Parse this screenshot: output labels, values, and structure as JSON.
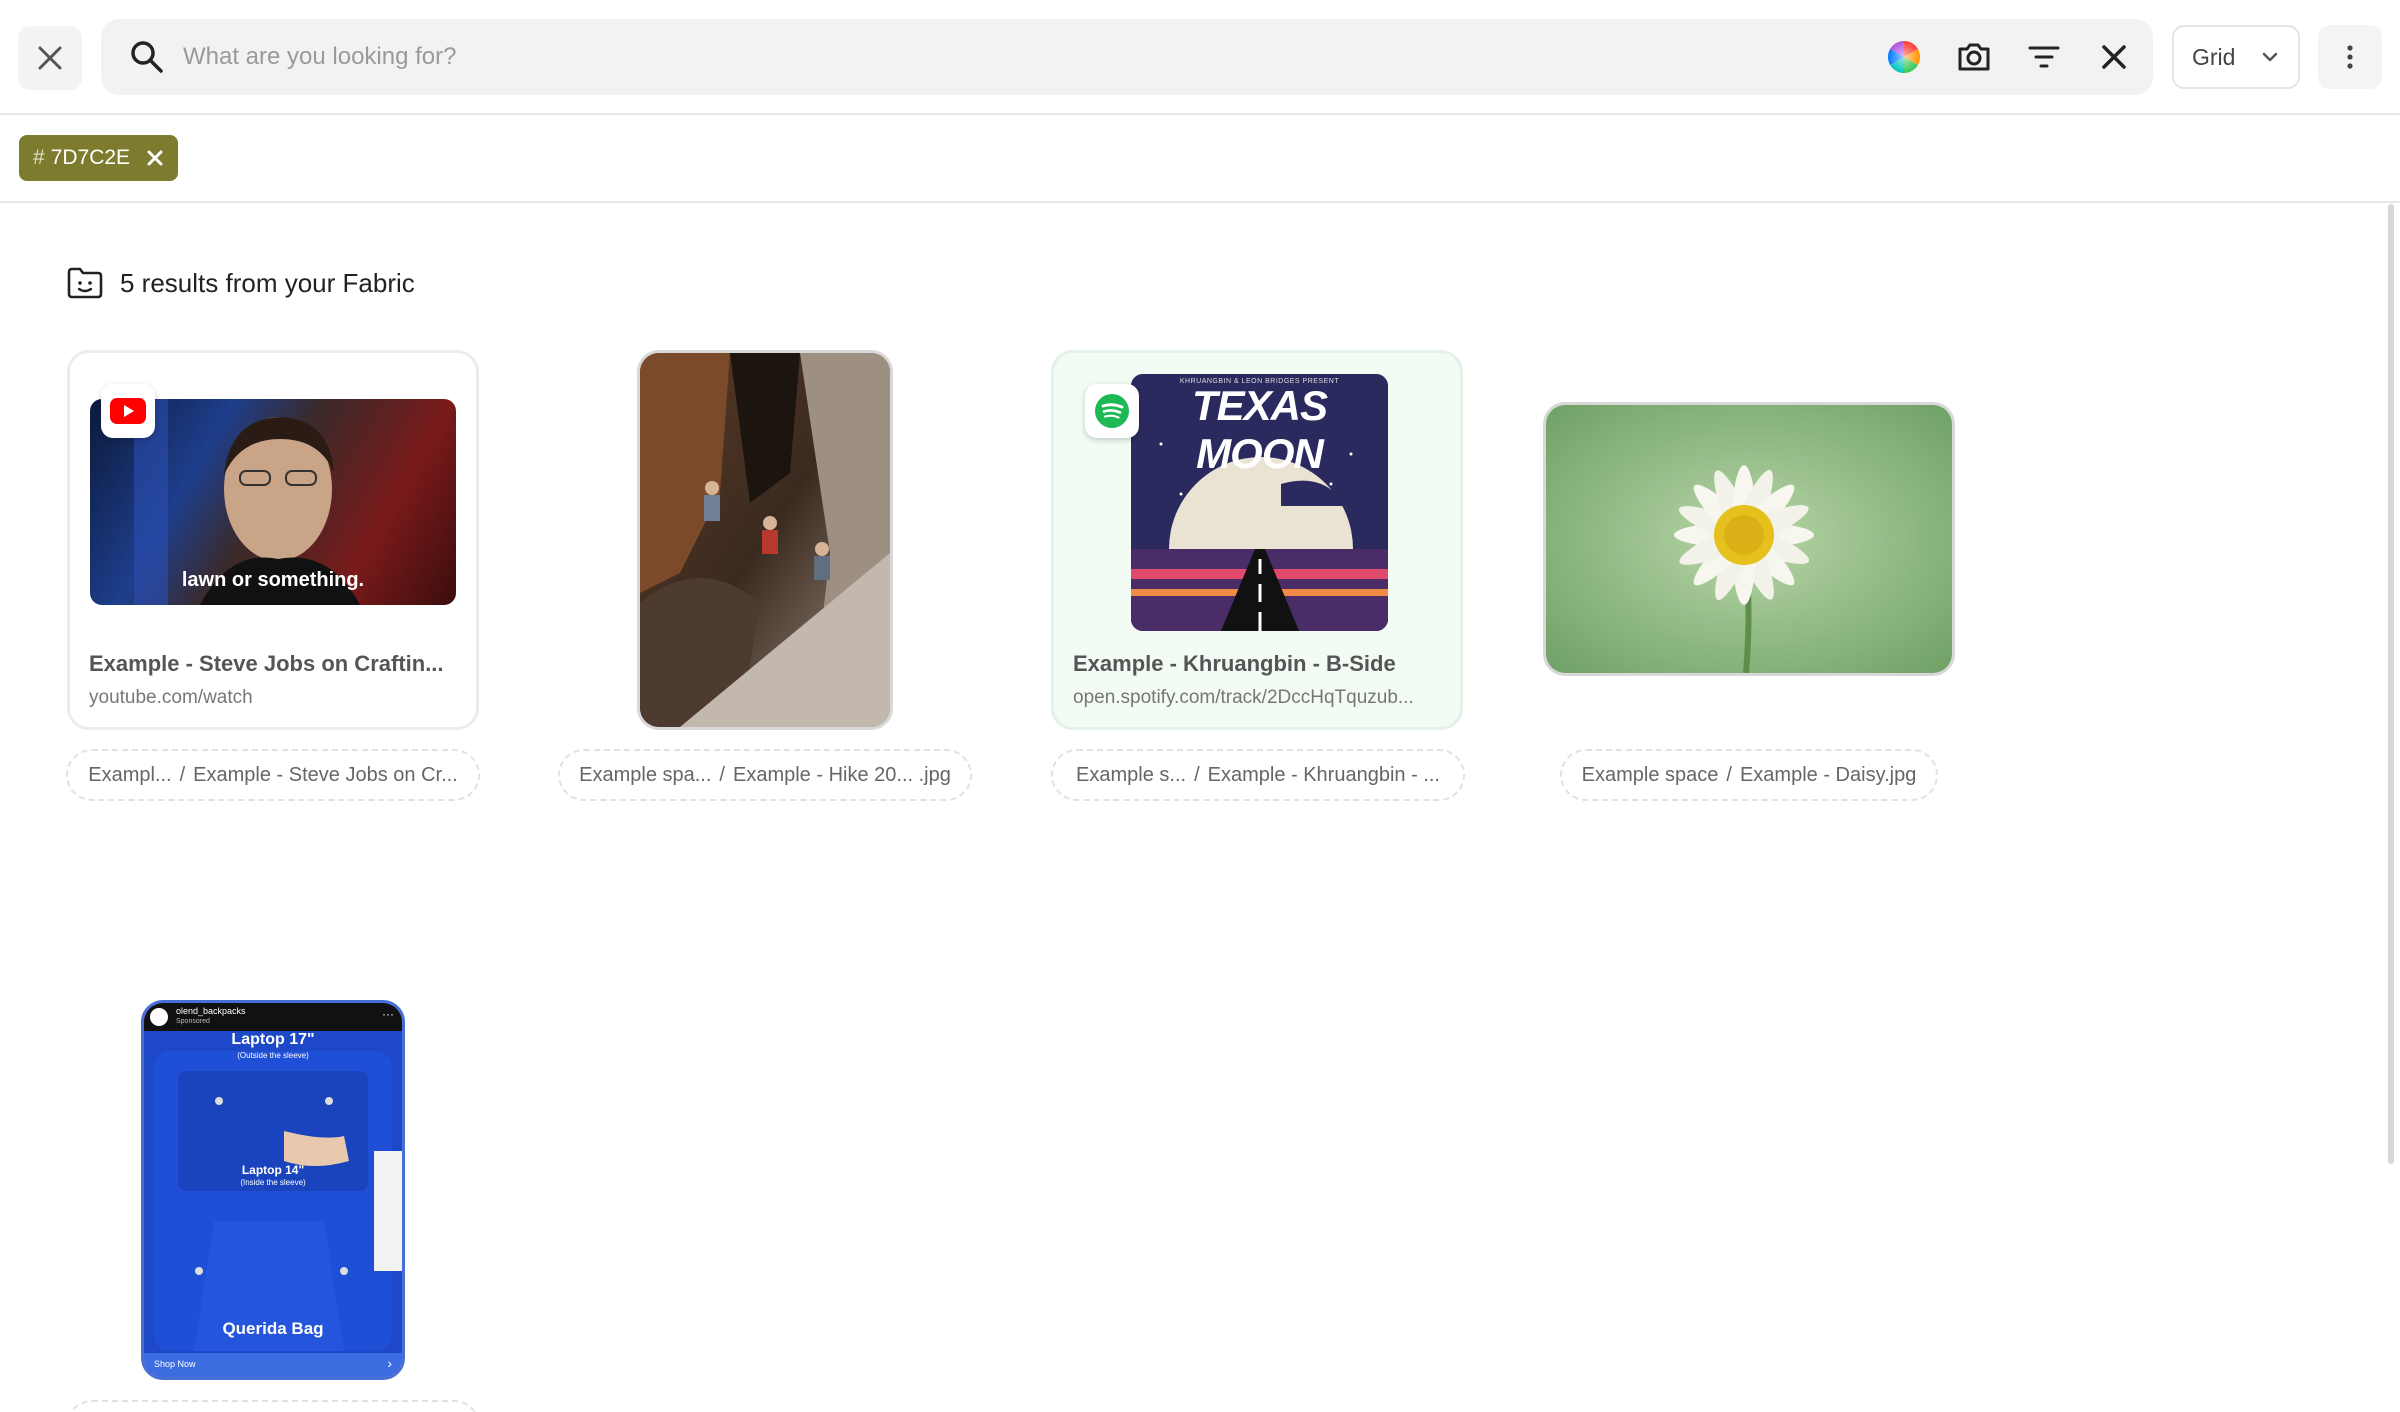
{
  "search": {
    "placeholder": "What are you looking for?"
  },
  "view_select": {
    "label": "Grid"
  },
  "filter": {
    "hash": "#",
    "color_label": "7D7C2E",
    "color": "#7D7C2E"
  },
  "results": {
    "label": "5 results from your Fabric"
  },
  "cards": [
    {
      "title": "Example - Steve Jobs on Craftin...",
      "url": "youtube.com/watch",
      "caption": "lawn or something.",
      "source_icon": "youtube-icon",
      "breadcrumb_space": "Exampl...",
      "breadcrumb_item": "Example - Steve Jobs on Cr..."
    },
    {
      "breadcrumb_space": "Example spa...",
      "breadcrumb_item": "Example - Hike 20... .jpg"
    },
    {
      "title": "Example - Khruangbin - B-Side",
      "url": "open.spotify.com/track/2DccHqTquzub...",
      "source_icon": "spotify-icon",
      "album_small": "KHRUANGBIN & LEON BRIDGES PRESENT",
      "album_title": "TEXAS MOON",
      "breadcrumb_space": "Example s...",
      "breadcrumb_item": "Example - Khruangbin - ..."
    },
    {
      "breadcrumb_space": "Example space",
      "breadcrumb_item": "Example - Daisy.jpg"
    },
    {
      "ad_account": "olend_backpacks",
      "ad_sponsored": "Sponsored",
      "ad_line1": "Laptop 17\"",
      "ad_line1_sub": "(Outside the sleeve)",
      "ad_line2": "Laptop 14\"",
      "ad_line2_sub": "(Inside the sleeve)",
      "ad_product": "Querida Bag",
      "ad_cta": "Shop Now"
    }
  ],
  "colors": {
    "filter_chip": "#7D7C2E",
    "spotify_green": "#1DB954",
    "youtube_red": "#FF0000"
  }
}
